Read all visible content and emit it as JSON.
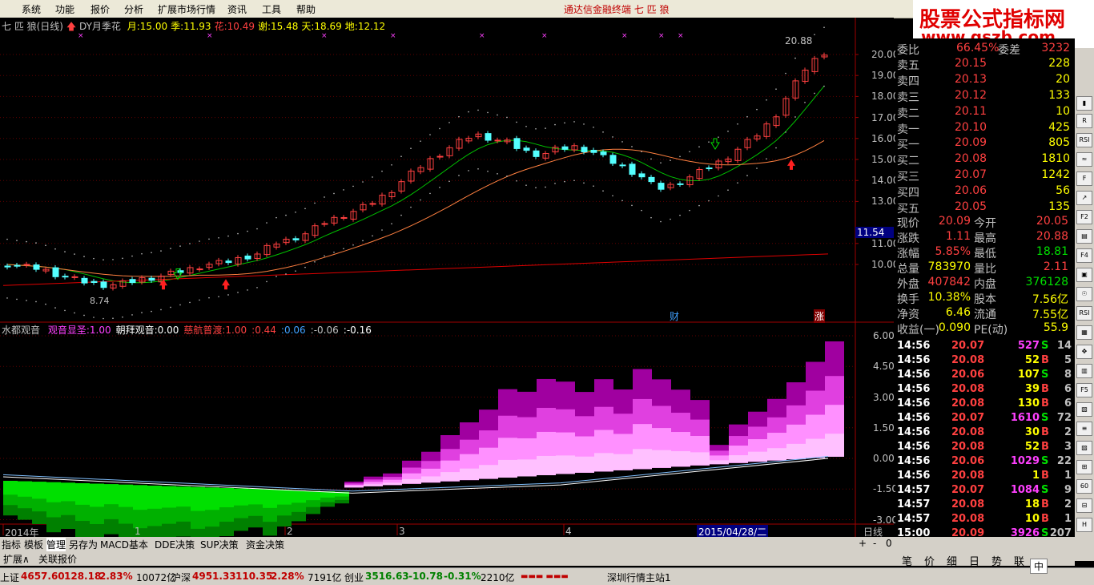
{
  "menu": {
    "items": [
      "系统",
      "功能",
      "报价",
      "分析",
      "扩展市场行情",
      "资讯",
      "工具",
      "帮助"
    ],
    "app_title": "通达信金融终端   七 匹 狼"
  },
  "watermark": {
    "line1": "股票公式指标网",
    "line2": "www.gszb.com"
  },
  "main_header": {
    "stock": "七 匹 狼(日线)",
    "indicator": "DY月季花",
    "items": [
      {
        "label": "月:",
        "value": "15.00",
        "color": "#ffff00"
      },
      {
        "label": "季:",
        "value": "11.93",
        "color": "#ffff00"
      },
      {
        "label": "花:",
        "value": "10.49",
        "color": "#ff4040"
      },
      {
        "label": "谢:",
        "value": "15.48",
        "color": "#ffff00"
      },
      {
        "label": "天:",
        "value": "18.69",
        "color": "#ffff00"
      },
      {
        "label": "地:",
        "value": "12.12",
        "color": "#ffff00"
      }
    ]
  },
  "price_axis": {
    "labels": [
      "20.00",
      "19.00",
      "18.00",
      "17.00",
      "16.00",
      "15.00",
      "14.00",
      "13.00",
      "11.00",
      "10.00"
    ],
    "current_tag": "11.54",
    "high_label": "20.88",
    "low_label": "8.74"
  },
  "chart_marks": {
    "cai": "财",
    "zhang": "涨"
  },
  "sub_header": {
    "name": "水都观音",
    "items": [
      {
        "label": "观音显圣:",
        "value": "1.00",
        "color": "#ff40ff"
      },
      {
        "label": "朝拜观音:",
        "value": "0.00",
        "color": "#ffffff"
      },
      {
        "label": "慈航普渡:",
        "value": "1.00",
        "color": "#ff4040"
      },
      {
        "label": ":",
        "value": "0.44",
        "color": "#ff4040"
      },
      {
        "label": ":",
        "value": "0.06",
        "color": "#40a0ff"
      },
      {
        "label": ":",
        "value": "-0.06",
        "color": "#c0c0c0"
      },
      {
        "label": ":",
        "value": "-0.16",
        "color": "#ffffff"
      }
    ]
  },
  "sub_axis": {
    "labels": [
      "6.00",
      "4.50",
      "3.00",
      "1.50",
      "0.00",
      "-1.50",
      "-3.00"
    ]
  },
  "time_axis": {
    "labels": [
      "2014年",
      "1",
      "2",
      "3",
      "4"
    ],
    "cursor": "2015/04/28/二",
    "period": "日线"
  },
  "order_book": {
    "header": {
      "label": "委比",
      "value": "66.45%",
      "label2": "委差",
      "value2": "3232"
    },
    "sell": [
      {
        "label": "卖五",
        "price": "20.15",
        "vol": "228"
      },
      {
        "label": "卖四",
        "price": "20.13",
        "vol": "20"
      },
      {
        "label": "卖三",
        "price": "20.12",
        "vol": "133"
      },
      {
        "label": "卖二",
        "price": "20.11",
        "vol": "10"
      },
      {
        "label": "卖一",
        "price": "20.10",
        "vol": "425"
      }
    ],
    "buy": [
      {
        "label": "买一",
        "price": "20.09",
        "vol": "805"
      },
      {
        "label": "买二",
        "price": "20.08",
        "vol": "1810"
      },
      {
        "label": "买三",
        "price": "20.07",
        "vol": "1242"
      },
      {
        "label": "买四",
        "price": "20.06",
        "vol": "56"
      },
      {
        "label": "买五",
        "price": "20.05",
        "vol": "135"
      }
    ]
  },
  "quote": [
    {
      "l1": "现价",
      "v1": "20.09",
      "c1": "#ff4040",
      "l2": "今开",
      "v2": "20.05",
      "c2": "#ff4040"
    },
    {
      "l1": "涨跌",
      "v1": "1.11",
      "c1": "#ff4040",
      "l2": "最高",
      "v2": "20.88",
      "c2": "#ff4040"
    },
    {
      "l1": "涨幅",
      "v1": "5.85%",
      "c1": "#ff4040",
      "l2": "最低",
      "v2": "18.81",
      "c2": "#00e000"
    },
    {
      "l1": "总量",
      "v1": "783970",
      "c1": "#ffff00",
      "l2": "量比",
      "v2": "2.11",
      "c2": "#ff4040"
    },
    {
      "l1": "外盘",
      "v1": "407842",
      "c1": "#ff4040",
      "l2": "内盘",
      "v2": "376128",
      "c2": "#00e000"
    },
    {
      "l1": "换手",
      "v1": "10.38%",
      "c1": "#ffff00",
      "l2": "股本",
      "v2": "7.56亿",
      "c2": "#ffff00"
    },
    {
      "l1": "净资",
      "v1": "6.46",
      "c1": "#ffff00",
      "l2": "流通",
      "v2": "7.55亿",
      "c2": "#ffff00"
    },
    {
      "l1": "收益(一)",
      "v1": "0.090",
      "c1": "#ffff00",
      "l2": "PE(动)",
      "v2": "55.9",
      "c2": "#ffff00"
    }
  ],
  "ticks": [
    {
      "t": "14:56",
      "p": "20.07",
      "v": "527",
      "s": "S",
      "n": "14"
    },
    {
      "t": "14:56",
      "p": "20.08",
      "v": "52",
      "s": "B",
      "n": "5"
    },
    {
      "t": "14:56",
      "p": "20.06",
      "v": "107",
      "s": "S",
      "n": "8"
    },
    {
      "t": "14:56",
      "p": "20.08",
      "v": "39",
      "s": "B",
      "n": "6"
    },
    {
      "t": "14:56",
      "p": "20.08",
      "v": "130",
      "s": "B",
      "n": "6"
    },
    {
      "t": "14:56",
      "p": "20.07",
      "v": "1610",
      "s": "S",
      "n": "72"
    },
    {
      "t": "14:56",
      "p": "20.08",
      "v": "30",
      "s": "B",
      "n": "2"
    },
    {
      "t": "14:56",
      "p": "20.08",
      "v": "52",
      "s": "B",
      "n": "3"
    },
    {
      "t": "14:56",
      "p": "20.06",
      "v": "1029",
      "s": "S",
      "n": "22"
    },
    {
      "t": "14:56",
      "p": "20.08",
      "v": "1",
      "s": "B",
      "n": "1"
    },
    {
      "t": "14:57",
      "p": "20.07",
      "v": "1084",
      "s": "S",
      "n": "9"
    },
    {
      "t": "14:57",
      "p": "20.08",
      "v": "18",
      "s": "B",
      "n": "2"
    },
    {
      "t": "14:57",
      "p": "20.08",
      "v": "10",
      "s": "B",
      "n": "1"
    },
    {
      "t": "15:00",
      "p": "20.09",
      "v": "3926",
      "s": "S",
      "n": "207"
    }
  ],
  "bottom_tabs": [
    "指标",
    "模板",
    "管理",
    "另存为",
    "MACD基本",
    "DDE决策",
    "SUP决策",
    "资金决策"
  ],
  "bottom_tabs2": [
    "扩展∧",
    "关联报价"
  ],
  "right_tabs": [
    "笔",
    "价",
    "细",
    "日",
    "势",
    "联"
  ],
  "status": [
    {
      "label": "上证",
      "value": "4657.60",
      "chg": "128.18",
      "pct": "2.83%",
      "amt": "10072亿"
    },
    {
      "label": "沪深",
      "value": "4951.33",
      "chg": "110.35",
      "pct": "2.28%",
      "amt": "7191亿"
    },
    {
      "label": "创业",
      "value": "3516.63",
      "chg": "-10.78",
      "pct": "-0.31%",
      "amt": "2210亿"
    }
  ],
  "status_server": "深圳行情主站1",
  "ime": "中",
  "colors": {
    "up": "#ff4040",
    "down": "#54ffff",
    "ma1": "#00c000",
    "ma2": "#ff8040",
    "ma3": "#e00000",
    "sub_pink": "#ff80ff",
    "sub_green": "#00e000"
  }
}
